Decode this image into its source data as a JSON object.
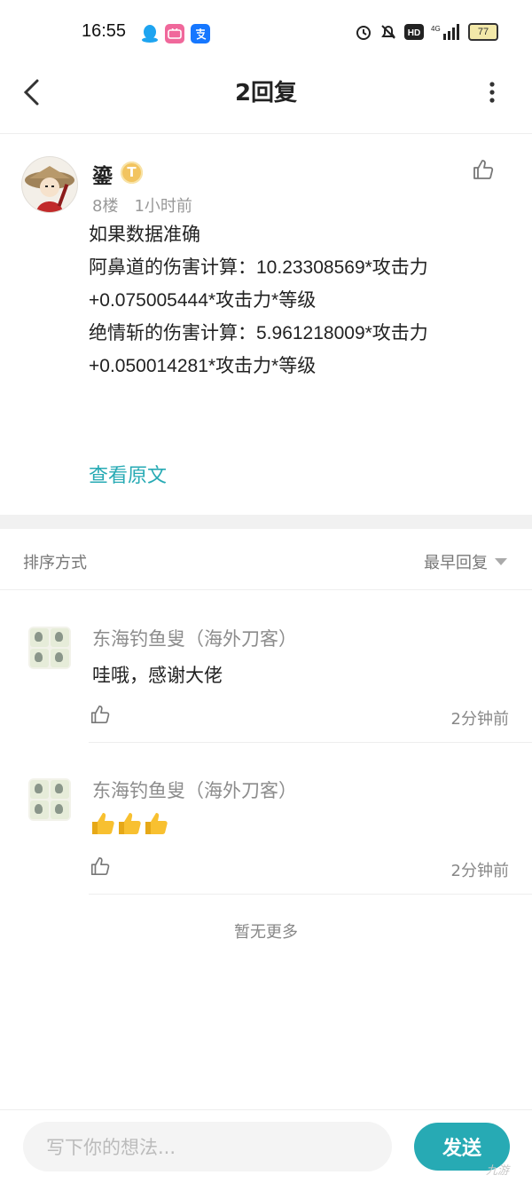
{
  "status_bar": {
    "time": "16:55",
    "battery": "77",
    "apps": [
      "qq-icon",
      "bilibili-icon",
      "alipay-icon"
    ]
  },
  "header": {
    "title": "2回复",
    "back_icon": "chevron-left-icon",
    "more_icon": "more-vertical-icon"
  },
  "post": {
    "user_name": "鎏",
    "level_badge": "T",
    "floor": "8楼",
    "time": "1小时前",
    "body": "如果数据准确\n阿鼻道的伤害计算：10.23308569*攻击力+0.075005444*攻击力*等级\n绝情斩的伤害计算：5.961218009*攻击力+0.050014281*攻击力*等级",
    "view_original": "查看原文"
  },
  "sort": {
    "label": "排序方式",
    "selected": "最早回复"
  },
  "replies": [
    {
      "name": "东海钓鱼叟（海外刀客）",
      "text": "哇哦，感谢大佬",
      "time": "2分钟前"
    },
    {
      "name": "东海钓鱼叟（海外刀客）",
      "text": "",
      "emojis": [
        "👍",
        "👍",
        "👍"
      ],
      "time": "2分钟前"
    }
  ],
  "footer_note": "暂无更多",
  "composer": {
    "placeholder": "写下你的想法...",
    "send_label": "发送"
  },
  "watermark": "九游",
  "colors": {
    "accent": "#27aab4",
    "badge": "#f2c460"
  }
}
